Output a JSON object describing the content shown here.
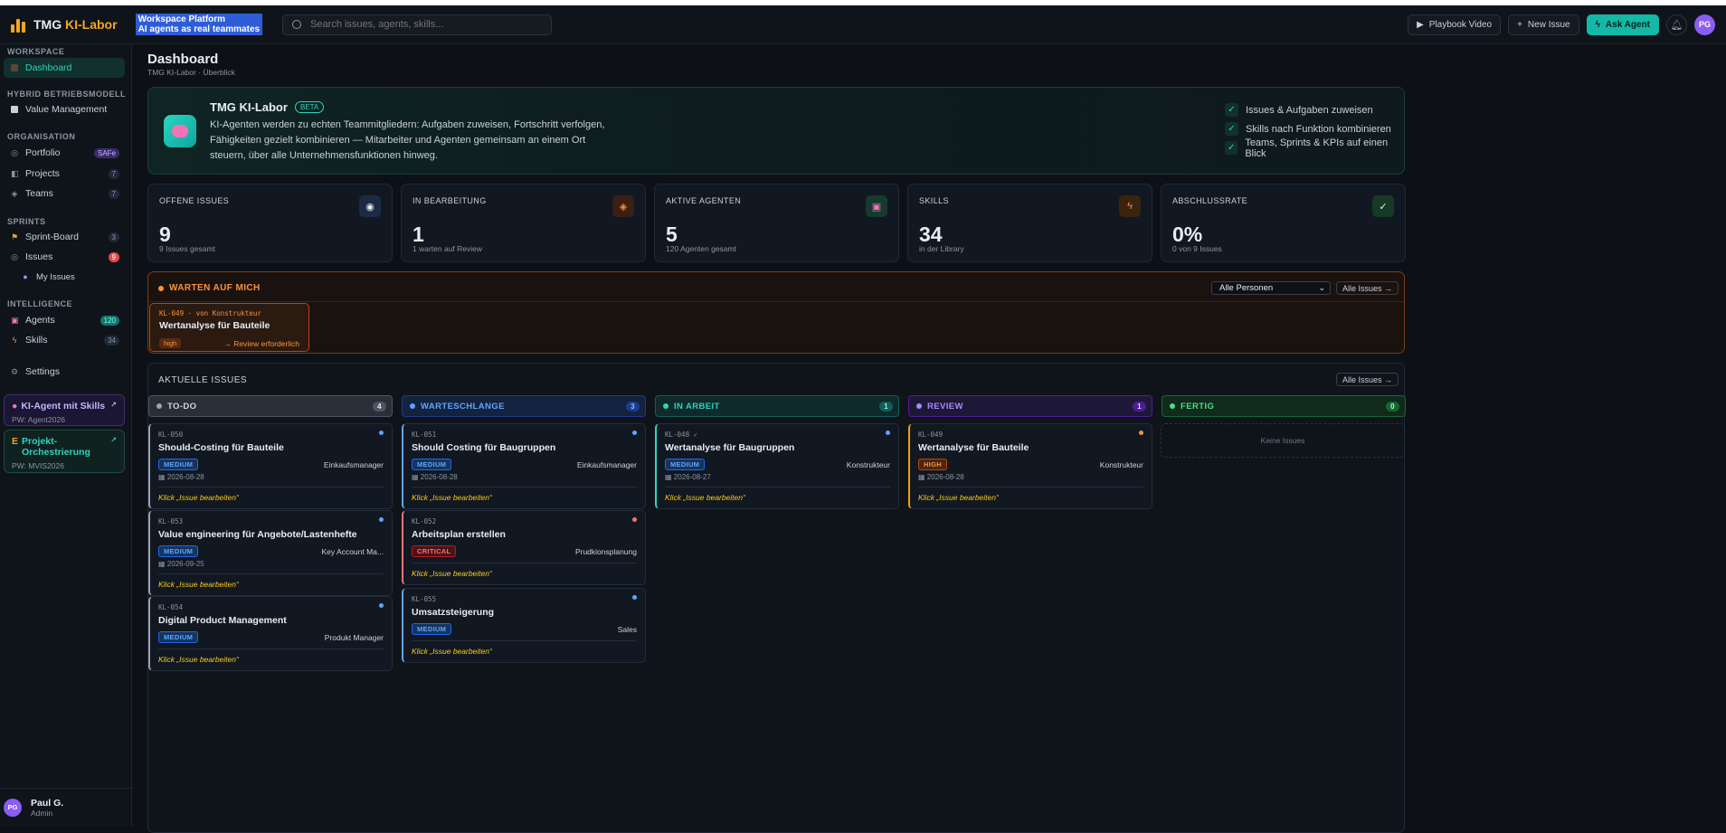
{
  "topbar": {
    "brand_a": "TMG ",
    "brand_b": "KI-Labor",
    "tagline_1": "Workspace Platform",
    "tagline_2": "AI agents as real teammates",
    "search_placeholder": "Search issues, agents, skills...",
    "playbook": "Playbook Video",
    "new_issue": "New Issue",
    "ask_agent": "Ask Agent",
    "avatar": "PG"
  },
  "sidebar": {
    "sec_workspace": "WORKSPACE",
    "dashboard": "Dashboard",
    "sec_hybrid": "HYBRID BETRIEBSMODELL",
    "value_mgmt": "Value Management",
    "sec_org": "ORGANISATION",
    "portfolio": "Portfolio",
    "portfolio_badge": "SAFe",
    "projects": "Projects",
    "projects_count": "7",
    "teams": "Teams",
    "teams_count": "7",
    "sec_sprints": "SPRINTS",
    "sprint_board": "Sprint-Board",
    "sprint_count": "3",
    "issues": "Issues",
    "issues_count": "9",
    "my_issues": "My Issues",
    "sec_intel": "INTELLIGENCE",
    "agents": "Agents",
    "agents_count": "120",
    "skills": "Skills",
    "skills_count": "34",
    "settings": "Settings",
    "promo1_title": "KI-Agent mit Skills",
    "promo1_pw": "PW: Agent2026",
    "promo2_title_1": "Projekt-",
    "promo2_title_2": "Orchestrierung",
    "promo2_pw": "PW: MVIS2026",
    "user_initials": "PG",
    "user_name": "Paul G.",
    "user_role": "Admin"
  },
  "page": {
    "title": "Dashboard",
    "breadcrumb": "TMG KI-Labor · Überblick"
  },
  "hero": {
    "title": "TMG KI-Labor",
    "badge": "BETA",
    "description": "KI-Agenten werden zu echten Teammitgliedern: Aufgaben zuweisen, Fortschritt verfolgen, Fähigkeiten gezielt kombinieren — Mitarbeiter und Agenten gemeinsam an einem Ort steuern, über alle Unternehmensfunktionen hinweg.",
    "checks": [
      "Issues & Aufgaben zuweisen",
      "Skills nach Funktion kombinieren",
      "Teams, Sprints & KPIs auf einen Blick"
    ]
  },
  "stats": [
    {
      "label": "OFFENE ISSUES",
      "value": "9",
      "sub": "9 Issues gesamt",
      "icon": "target-icon",
      "glyph": "◉"
    },
    {
      "label": "IN BEARBEITUNG",
      "value": "1",
      "sub": "1 warten auf Review",
      "icon": "diamond-icon",
      "glyph": "◈"
    },
    {
      "label": "AKTIVE AGENTEN",
      "value": "5",
      "sub": "120 Agenten gesamt",
      "icon": "robot-icon",
      "glyph": "▣"
    },
    {
      "label": "SKILLS",
      "value": "34",
      "sub": "in der Library",
      "icon": "lightning-icon",
      "glyph": "ϟ"
    },
    {
      "label": "ABSCHLUSSRATE",
      "value": "0%",
      "sub": "0 von 9 Issues",
      "icon": "check-icon",
      "glyph": "✓"
    }
  ],
  "waiting": {
    "title": "WARTEN AUF MICH",
    "filter_value": "Alle Personen",
    "all_issues": "Alle Issues →",
    "card": {
      "id": "KL-049 · von Konstrukteur",
      "title": "Wertanalyse für Bauteile",
      "priority": "high",
      "action": "→ Review erforderlich"
    }
  },
  "issues": {
    "title": "AKTUELLE ISSUES",
    "all_issues": "Alle Issues →",
    "empty": "Keine Issues",
    "columns": [
      {
        "name": "TO-DO",
        "count": "4"
      },
      {
        "name": "WARTESCHLANGE",
        "count": "3"
      },
      {
        "name": "IN ARBEIT",
        "count": "1"
      },
      {
        "name": "REVIEW",
        "count": "1"
      },
      {
        "name": "FERTIG",
        "count": "0"
      }
    ],
    "cards": [
      {
        "id": "KL-050",
        "title": "Should-Costing für Bauteile",
        "priority": "MEDIUM",
        "owner": "Einkaufsmanager",
        "date": "2026-08-28",
        "action": "Klick „Issue bearbeiten“"
      },
      {
        "id": "KL-053",
        "title": "Value engineering für Angebote/Lastenhefte",
        "priority": "MEDIUM",
        "owner": "Key Account Ma...",
        "date": "2026-09-25",
        "action": "Klick „Issue bearbeiten“"
      },
      {
        "id": "KL-054",
        "title": "Digital Product Management",
        "priority": "MEDIUM",
        "owner": "Produkt Manager",
        "date": "",
        "action": "Klick „Issue bearbeiten“"
      },
      {
        "id": "KL-051",
        "title": "Should Costing für Baugruppen",
        "priority": "MEDIUM",
        "owner": "Einkaufsmanager",
        "date": "2026-08-28",
        "action": "Klick „Issue bearbeiten“"
      },
      {
        "id": "KL-052",
        "title": "Arbeitsplan erstellen",
        "priority": "CRITICAL",
        "owner": "Prudkionsplanung",
        "date": "",
        "action": "Klick „Issue bearbeiten“"
      },
      {
        "id": "KL-055",
        "title": "Umsatzsteigerung",
        "priority": "MEDIUM",
        "owner": "Sales",
        "date": "",
        "action": "Klick „Issue bearbeiten“"
      },
      {
        "id": "KL-048 ✓",
        "title": "Wertanalyse für Baugruppen",
        "priority": "MEDIUM",
        "owner": "Konstrukteur",
        "date": "2026-08-27",
        "action": "Klick „Issue bearbeiten“"
      },
      {
        "id": "KL-049",
        "title": "Wertanalyse für Bauteile",
        "priority": "HIGH",
        "owner": "Konstrukteur",
        "date": "2026-08-28",
        "action": "Klick „Issue bearbeiten“"
      }
    ]
  },
  "colors": {
    "accent": "#14b8a6",
    "brand": "#f5a524",
    "todo": "#9ca3af",
    "queue": "#60a5fa",
    "progress": "#2dd4bf",
    "review": "#a78bfa",
    "done": "#4ade80"
  }
}
